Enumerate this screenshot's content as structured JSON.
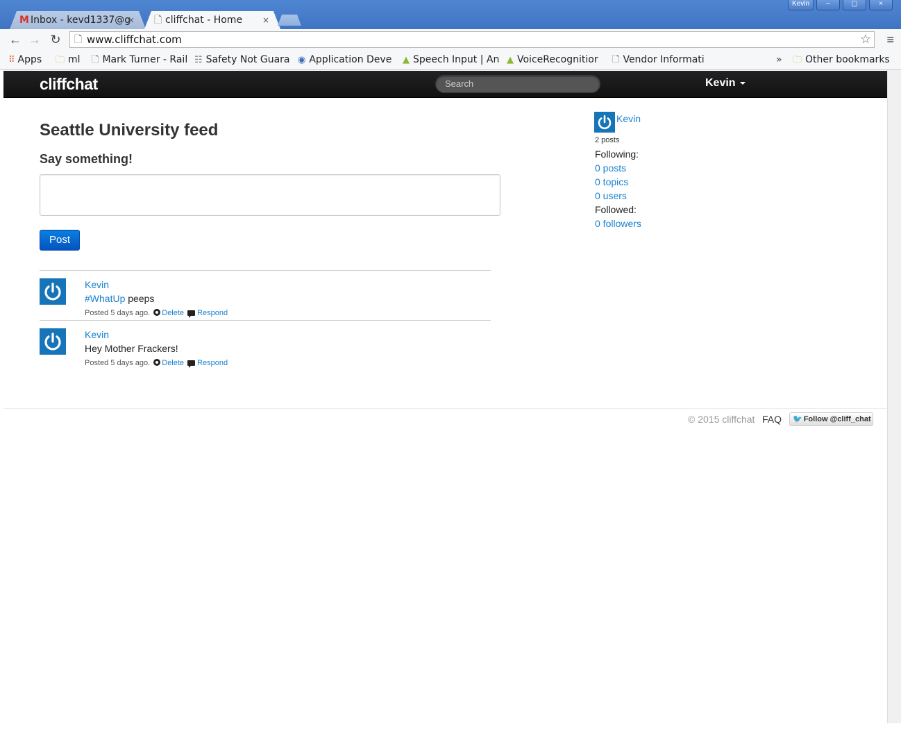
{
  "browser": {
    "window_buttons": [
      "Kevin",
      "–",
      "▢",
      "×"
    ],
    "tabs": [
      {
        "title": "Inbox - kevd1337@g",
        "icon": "gmail-icon",
        "active": false
      },
      {
        "title": "cliffchat - Home",
        "icon": "page-icon",
        "active": true
      }
    ],
    "tab_close": "×",
    "url": "www.cliffchat.com",
    "bookmarks": [
      {
        "label": "Apps",
        "icon": "apps-icon"
      },
      {
        "label": "ml",
        "icon": "folder-icon"
      },
      {
        "label": "Mark Turner - Rail",
        "icon": "page-icon"
      },
      {
        "label": "Safety Not Guara",
        "icon": "sign-icon"
      },
      {
        "label": "Application Deve",
        "icon": "globe-icon"
      },
      {
        "label": "Speech Input | An",
        "icon": "android-icon"
      },
      {
        "label": "VoiceRecognitior",
        "icon": "android-icon"
      },
      {
        "label": "Vendor Informati",
        "icon": "page-icon"
      }
    ],
    "bookmarks_overflow": "»",
    "other_bookmarks": "Other bookmarks"
  },
  "navbar": {
    "brand": "cliffchat",
    "search_placeholder": "Search",
    "user": "Kevin"
  },
  "main": {
    "feed_title": "Seattle University feed",
    "compose_heading": "Say something!",
    "compose_value": "",
    "post_button": "Post",
    "posts": [
      {
        "user": "Kevin",
        "hashtag": "#WhatUp",
        "text": " peeps",
        "posted": "Posted 5 days ago.",
        "delete": "Delete",
        "respond": "Respond"
      },
      {
        "user": "Kevin",
        "hashtag": "",
        "text": "Hey Mother Frackers!",
        "posted": "Posted 5 days ago.",
        "delete": "Delete",
        "respond": "Respond"
      }
    ]
  },
  "sidebar": {
    "user": "Kevin",
    "post_count": "2 posts",
    "following_label": "Following:",
    "following_links": [
      "0 posts",
      "0 topics",
      "0 users"
    ],
    "followed_label": "Followed:",
    "followers_link": "0 followers"
  },
  "footer": {
    "copyright": "© 2015 cliffchat",
    "faq": "FAQ",
    "twitter_follow": "Follow @cliff_chat"
  },
  "colors": {
    "link": "#1a82d0",
    "navbar": "#111111",
    "primary_button": "#0a6fd6",
    "avatar": "#1674b8"
  }
}
